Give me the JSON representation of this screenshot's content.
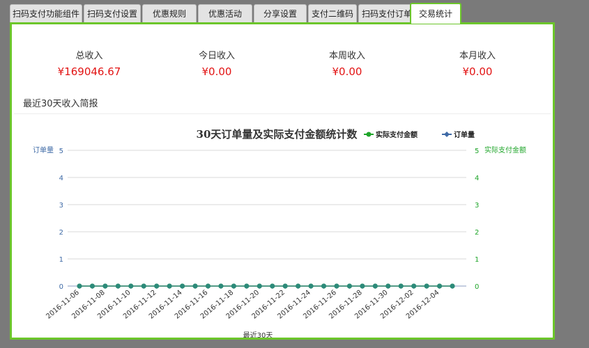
{
  "tabs": [
    {
      "label": "扫码支付功能组件",
      "active": false
    },
    {
      "label": "扫码支付设置",
      "active": false
    },
    {
      "label": "优惠规则",
      "active": false
    },
    {
      "label": "优惠活动",
      "active": false
    },
    {
      "label": "分享设置",
      "active": false
    },
    {
      "label": "支付二维码",
      "active": false
    },
    {
      "label": "扫码支付订单",
      "active": false
    },
    {
      "label": "交易统计",
      "active": true
    }
  ],
  "stats": [
    {
      "label": "总收入",
      "value": "¥169046.67"
    },
    {
      "label": "今日收入",
      "value": "¥0.00"
    },
    {
      "label": "本周收入",
      "value": "¥0.00"
    },
    {
      "label": "本月收入",
      "value": "¥0.00"
    }
  ],
  "section_title": "最近30天收入简报",
  "colors": {
    "accent_border": "#6cc62b",
    "income_value": "#e21414",
    "order_series": "#3e6aa6",
    "amount_series": "#1fa52a"
  },
  "chart_data": {
    "type": "line",
    "title": "30天订单量及实际支付金额统计数",
    "xlabel": "最近30天",
    "ylabel_left": "订单量",
    "ylabel_right": "实际支付金额",
    "ylim": [
      0,
      5
    ],
    "yticks": [
      0,
      1,
      2,
      3,
      4,
      5
    ],
    "legend_position": "top-right",
    "x": [
      "2016-11-06",
      "2016-11-07",
      "2016-11-08",
      "2016-11-09",
      "2016-11-10",
      "2016-11-11",
      "2016-11-12",
      "2016-11-13",
      "2016-11-14",
      "2016-11-15",
      "2016-11-16",
      "2016-11-17",
      "2016-11-18",
      "2016-11-19",
      "2016-11-20",
      "2016-11-21",
      "2016-11-22",
      "2016-11-23",
      "2016-11-24",
      "2016-11-25",
      "2016-11-26",
      "2016-11-27",
      "2016-11-28",
      "2016-11-29",
      "2016-11-30",
      "2016-12-01",
      "2016-12-02",
      "2016-12-03",
      "2016-12-04",
      "2016-12-05"
    ],
    "x_tick_labels": [
      "2016-11-06",
      "2016-11-08",
      "2016-11-10",
      "2016-11-12",
      "2016-11-14",
      "2016-11-16",
      "2016-11-18",
      "2016-11-20",
      "2016-11-22",
      "2016-11-24",
      "2016-11-26",
      "2016-11-28",
      "2016-11-30",
      "2016-12-02",
      "2016-12-04"
    ],
    "series": [
      {
        "name": "实际支付金额",
        "axis": "right",
        "values": [
          0,
          0,
          0,
          0,
          0,
          0,
          0,
          0,
          0,
          0,
          0,
          0,
          0,
          0,
          0,
          0,
          0,
          0,
          0,
          0,
          0,
          0,
          0,
          0,
          0,
          0,
          0,
          0,
          0,
          0
        ]
      },
      {
        "name": "订单量",
        "axis": "left",
        "values": [
          0,
          0,
          0,
          0,
          0,
          0,
          0,
          0,
          0,
          0,
          0,
          0,
          0,
          0,
          0,
          0,
          0,
          0,
          0,
          0,
          0,
          0,
          0,
          0,
          0,
          0,
          0,
          0,
          0,
          0
        ]
      }
    ]
  }
}
